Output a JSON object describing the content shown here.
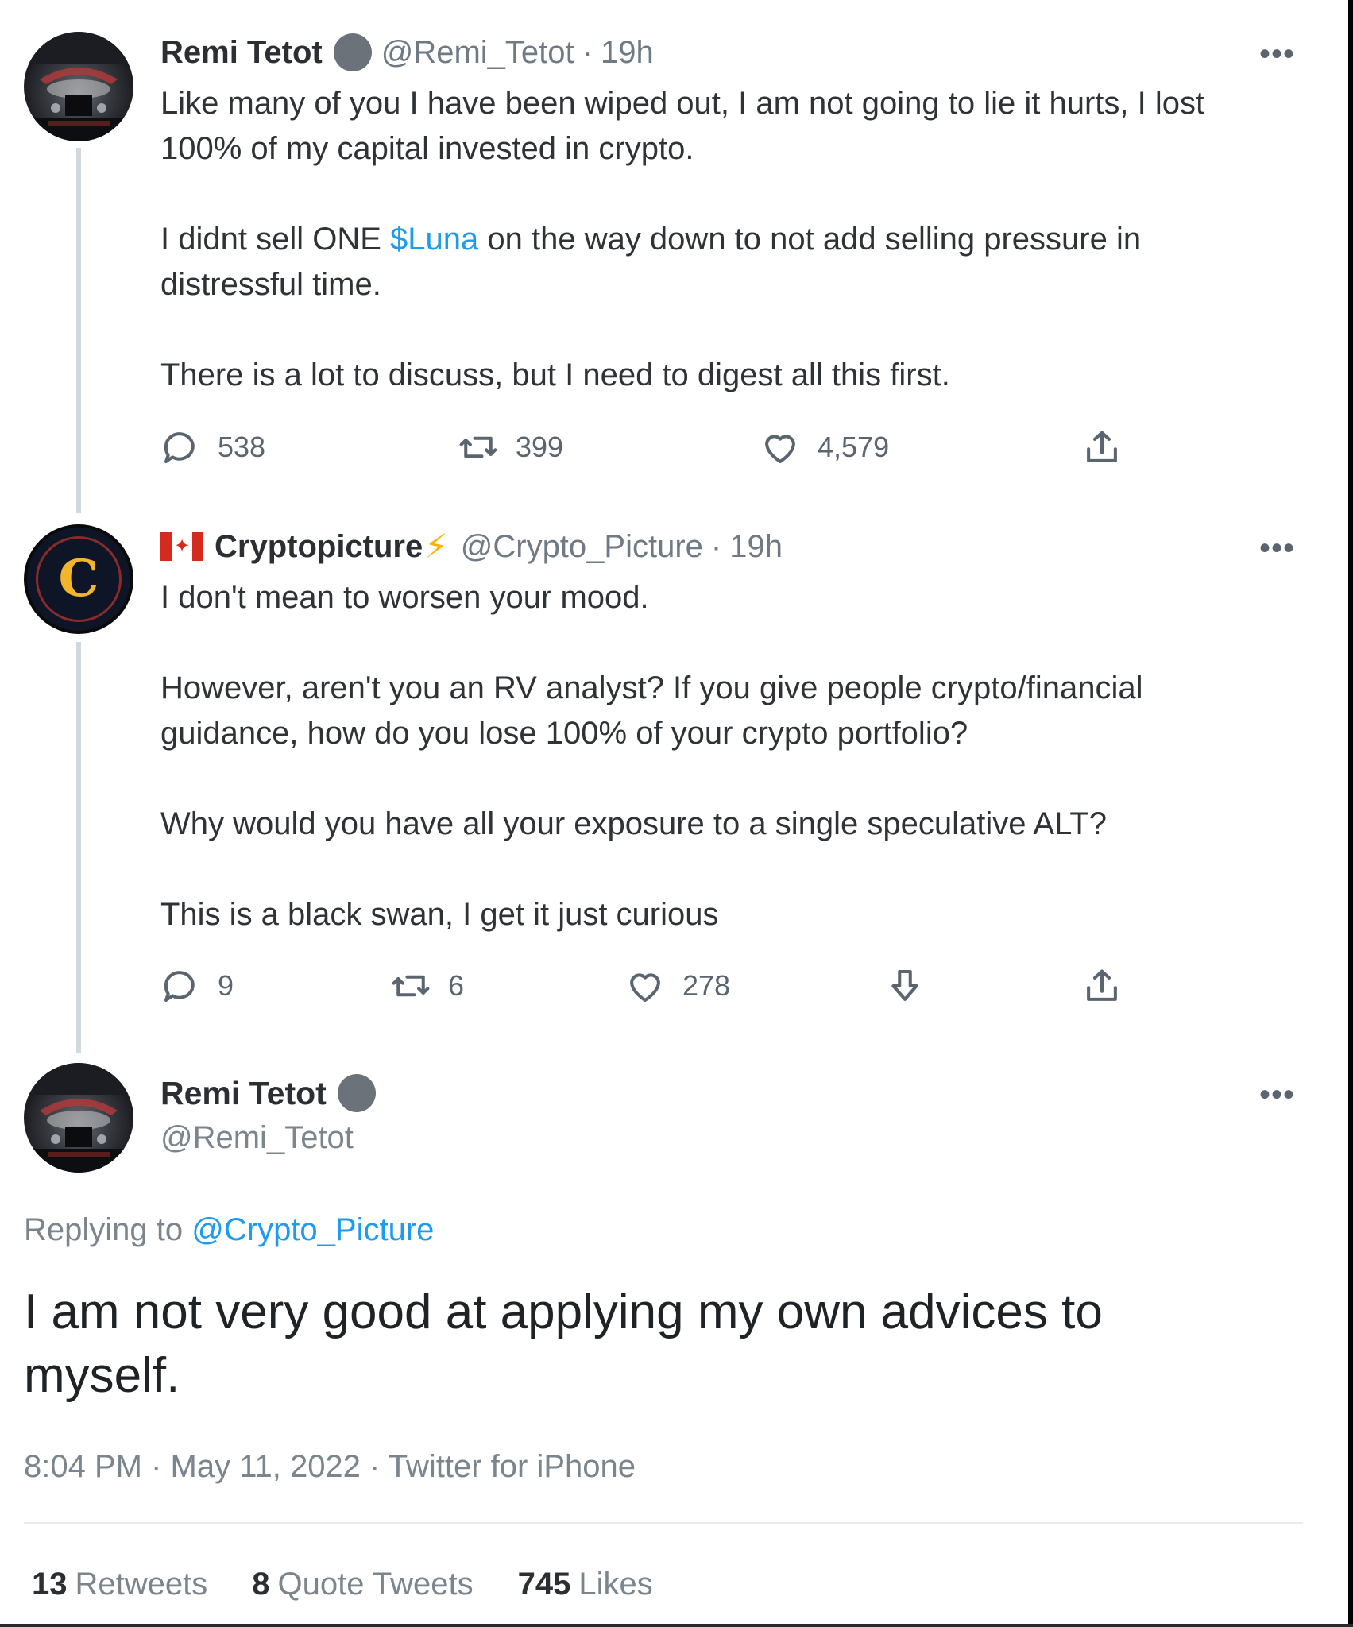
{
  "tweets": [
    {
      "name": "Remi Tetot",
      "handle": "@Remi_Tetot",
      "time": "19h",
      "paragraphs": [
        "Like many of you I have been wiped out, I am not going to lie it hurts, I lost 100% of my capital invested in crypto.",
        "There is a lot to discuss, but I need to digest all this first."
      ],
      "para2_before": "I didnt sell ONE ",
      "para2_link": "$Luna",
      "para2_after": " on the way down to not add selling pressure in distressful time.",
      "replies": "538",
      "retweets": "399",
      "likes": "4,579"
    },
    {
      "name": "Cryptopicture",
      "handle": "@Crypto_Picture",
      "time": "19h",
      "avatar_letter": "C",
      "paragraphs": [
        "I don't mean to worsen your mood.",
        "However, aren't you an RV analyst? If you give people crypto/financial guidance, how do you lose 100% of your crypto portfolio?",
        "Why would you have all your exposure to a single speculative ALT?",
        "This is a black swan, I get it just curious"
      ],
      "replies": "9",
      "retweets": "6",
      "likes": "278"
    }
  ],
  "main": {
    "name": "Remi Tetot",
    "handle": "@Remi_Tetot",
    "replying_label": "Replying to",
    "replying_to": "@Crypto_Picture",
    "text": "I am not very good at applying my own advices to myself.",
    "timestamp": "8:04 PM · May 11, 2022 · Twitter for iPhone",
    "retweets_count": "13",
    "retweets_label": "Retweets",
    "quotes_count": "8",
    "quotes_label": "Quote Tweets",
    "likes_count": "745",
    "likes_label": "Likes"
  },
  "ui": {
    "more_glyph": "•••",
    "separator": "·",
    "bolt_glyph": "⚡",
    "maple_glyph": "✦"
  },
  "colors": {
    "link": "#1d9bf0",
    "muted": "#7b858e",
    "verified_badge": "#6c7279",
    "thread_line": "#cfd9de"
  }
}
